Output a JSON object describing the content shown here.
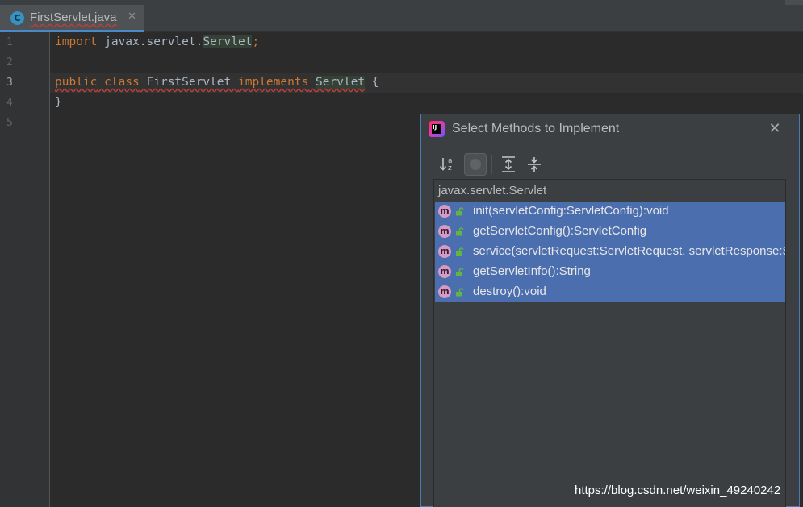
{
  "tab": {
    "icon_letter": "C",
    "label": "FirstServlet.java",
    "close": "✕"
  },
  "gutter": {
    "line_numbers": [
      "1",
      "2",
      "3",
      "4",
      "5"
    ]
  },
  "code": {
    "line1": {
      "kw_import": "import",
      "package": " javax.servlet.",
      "cls": "Servlet",
      "semi": ";"
    },
    "line3": {
      "kw_public": "public",
      "kw_class": " class",
      "name": " FirstServlet ",
      "kw_implements": "implements",
      "space": " ",
      "iface": "Servlet",
      "brace": " {"
    },
    "line4": "}"
  },
  "dialog": {
    "icon_text": "IJ",
    "title": "Select Methods to Implement",
    "close": "✕",
    "tree_header": "javax.servlet.Servlet",
    "methods": [
      "init(servletConfig:ServletConfig):void",
      "getServletConfig():ServletConfig",
      "service(servletRequest:ServletRequest, servletResponse:ServletResponse):void",
      "getServletInfo():String",
      "destroy():void"
    ],
    "method_icon_letter": "m"
  },
  "watermark": "https://blog.csdn.net/weixin_49240242",
  "colors": {
    "editor_bg": "#2b2b2b",
    "keyword": "#cc7832",
    "text": "#a9b7c6",
    "selection": "#4b6eaf",
    "dialog_border": "#4a7ab8"
  }
}
